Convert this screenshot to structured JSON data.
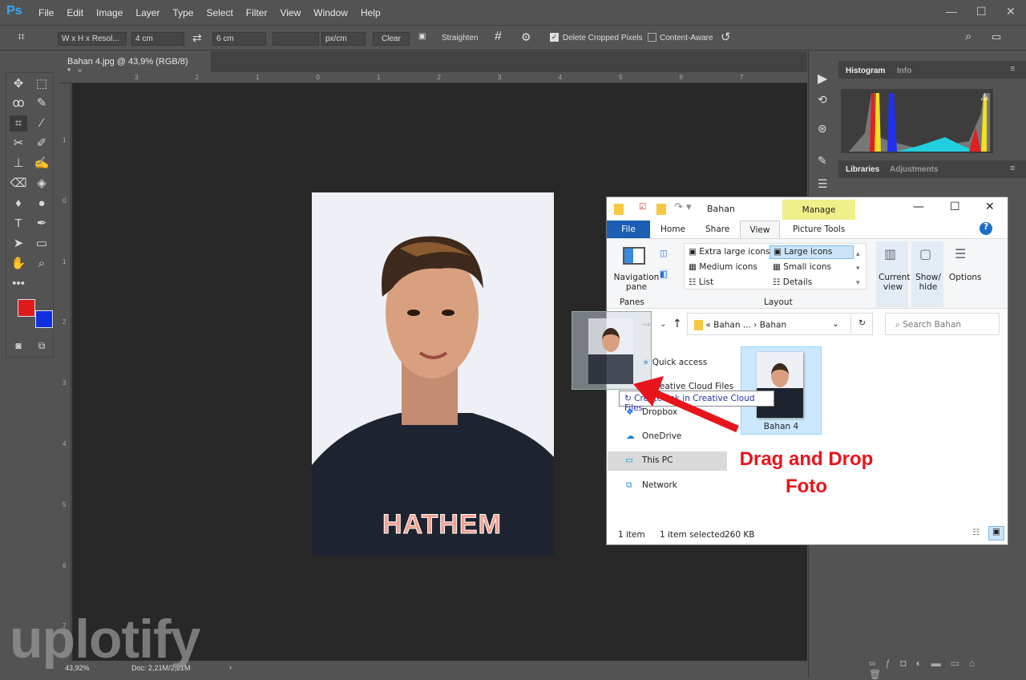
{
  "app": {
    "logo": "Ps",
    "menu": [
      "File",
      "Edit",
      "Image",
      "Layer",
      "Type",
      "Select",
      "Filter",
      "View",
      "Window",
      "Help"
    ]
  },
  "options": {
    "preset": "W x H x Resol...",
    "width": "4 cm",
    "height": "6 cm",
    "resolution": "",
    "unit": "px/cm",
    "clear": "Clear",
    "straighten": "Straighten",
    "delete_cropped": "Delete Cropped Pixels",
    "delete_cropped_checked": true,
    "content_aware": "Content-Aware",
    "content_aware_checked": false
  },
  "document": {
    "tab_title": "Bahan 4.jpg @ 43,9% (RGB/8) *",
    "zoom": "43,92%",
    "doc_info": "Doc: 2,21M/2,21M",
    "ruler_top": [
      "3",
      "2",
      "1",
      "0",
      "1",
      "2",
      "3",
      "4",
      "5",
      "6",
      "7"
    ],
    "ruler_left": [
      "1",
      "0",
      "1",
      "2",
      "3",
      "4",
      "5",
      "6",
      "7"
    ],
    "shirt_text": "HATHEM"
  },
  "colors": {
    "foreground": "#e01b1b",
    "background": "#1030e0",
    "accent": "#31a8ff"
  },
  "panels": {
    "tabs1": [
      "Histogram",
      "Info"
    ],
    "tabs2": [
      "Libraries",
      "Adjustments"
    ]
  },
  "explorer": {
    "title": "Bahan",
    "manage": "Manage",
    "tabs": [
      "File",
      "Home",
      "Share",
      "View",
      "Picture Tools"
    ],
    "panes": {
      "nav_pane": "Navigation pane",
      "group": "Panes"
    },
    "layout": {
      "items": [
        "Extra large icons",
        "Large icons",
        "Medium icons",
        "Small icons",
        "List",
        "Details"
      ],
      "selected": "Large icons",
      "group": "Layout"
    },
    "current_view": "Current view",
    "show_hide": "Show/ hide",
    "options": "Options",
    "breadcrumb": [
      "Bahan ...",
      "Bahan"
    ],
    "search_placeholder": "Search Bahan",
    "nav": [
      "Quick access",
      "Creative Cloud Files",
      "Dropbox",
      "OneDrive",
      "This PC",
      "Network"
    ],
    "tooltip": "Create link in Creative Cloud Files",
    "file": {
      "name": "Bahan 4"
    },
    "status": {
      "count": "1 item",
      "selected": "1 item selected",
      "size": "260 KB"
    }
  },
  "annotation": {
    "line1": "Drag and Drop",
    "line2": "Foto"
  },
  "watermark": "uplotify"
}
